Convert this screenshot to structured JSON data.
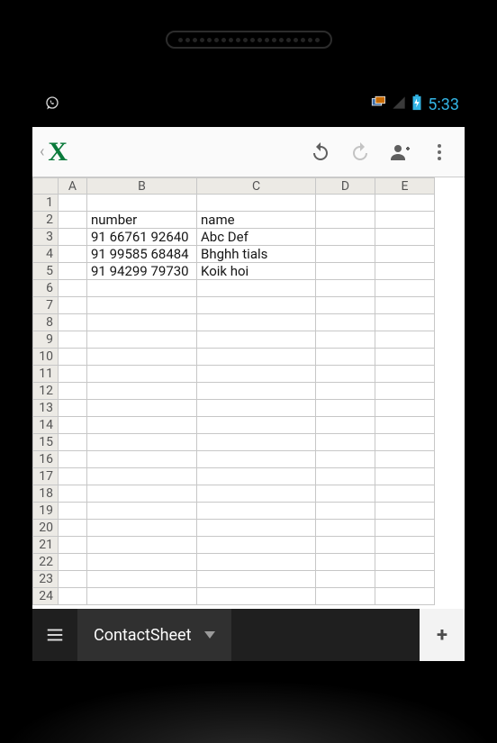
{
  "status_bar": {
    "clock": "5:33"
  },
  "toolbar": {
    "undo_label": "Undo",
    "redo_label": "Redo",
    "add_contact_label": "Add contact",
    "more_label": "More"
  },
  "sheet": {
    "columns": [
      "A",
      "B",
      "C",
      "D",
      "E"
    ],
    "row_count": 24,
    "cells": {
      "B2": "number",
      "C2": "name",
      "B3": "91 66761 92640",
      "C3": "Abc Def",
      "B4": "91 99585 68484",
      "C4": "Bhghh tials",
      "B5": "91 94299 79730",
      "C5": "Koik hoi"
    }
  },
  "sheetbar": {
    "active_tab": "ContactSheet",
    "add_label": "+"
  }
}
